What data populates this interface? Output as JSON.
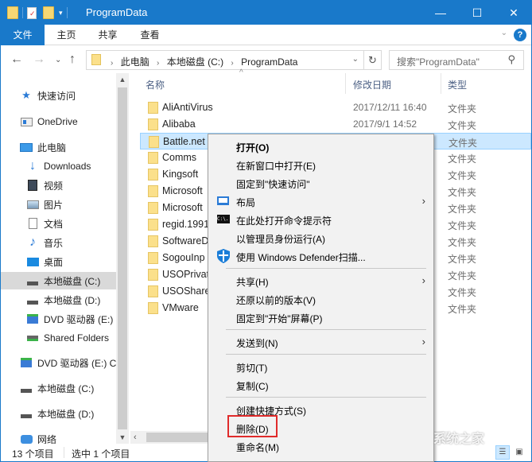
{
  "window": {
    "title": "ProgramData",
    "controls": {
      "minimize": "—",
      "maximize": "☐",
      "close": "✕"
    }
  },
  "ribbon": {
    "tabs": [
      {
        "label": "文件",
        "active": true
      },
      {
        "label": "主页"
      },
      {
        "label": "共享"
      },
      {
        "label": "查看"
      }
    ],
    "help": "?",
    "expand": "⌄"
  },
  "navigation": {
    "back": "←",
    "forward": "→",
    "recent": "⌄",
    "up": "↑",
    "breadcrumbs": [
      "此电脑",
      "本地磁盘 (C:)",
      "ProgramData"
    ],
    "separator": "›",
    "dropdown": "⌄",
    "refresh": "↻",
    "search_placeholder": "搜索\"ProgramData\"",
    "search_icon": "⚲"
  },
  "sidebar": {
    "items": [
      {
        "label": "快速访问",
        "icon": "star-icon"
      },
      {
        "label": "OneDrive",
        "icon": "onedrive-icon"
      },
      {
        "label": "此电脑",
        "icon": "computer-icon"
      },
      {
        "label": "Downloads",
        "icon": "download-icon"
      },
      {
        "label": "视频",
        "icon": "video-icon"
      },
      {
        "label": "图片",
        "icon": "picture-icon"
      },
      {
        "label": "文档",
        "icon": "document-icon"
      },
      {
        "label": "音乐",
        "icon": "music-icon"
      },
      {
        "label": "桌面",
        "icon": "desktop-icon"
      },
      {
        "label": "本地磁盘 (C:)",
        "icon": "windows-drive-icon",
        "selected": true
      },
      {
        "label": "本地磁盘 (D:)",
        "icon": "drive-icon"
      },
      {
        "label": "DVD 驱动器 (E:)",
        "icon": "dvd-icon"
      },
      {
        "label": "Shared Folders",
        "icon": "network-drive-icon"
      },
      {
        "label": "DVD 驱动器 (E:) C",
        "icon": "dvd-icon"
      },
      {
        "label": "本地磁盘 (C:)",
        "icon": "windows-drive-icon"
      },
      {
        "label": "本地磁盘 (D:)",
        "icon": "drive-icon"
      },
      {
        "label": "网络",
        "icon": "network-icon"
      }
    ]
  },
  "filelist": {
    "sort_indicator": "^",
    "columns": [
      "名称",
      "修改日期",
      "类型"
    ],
    "rows": [
      {
        "name": "AliAntiVirus",
        "date": "2017/12/11 16:40",
        "type": "文件夹"
      },
      {
        "name": "Alibaba",
        "date": "2017/9/1 14:52",
        "type": "文件夹"
      },
      {
        "name": "Battle.net",
        "date": "",
        "type": "文件夹",
        "selected": true
      },
      {
        "name": "Comms",
        "date": "",
        "type": "文件夹"
      },
      {
        "name": "Kingsoft",
        "date": "",
        "type": "文件夹"
      },
      {
        "name": "Microsoft",
        "date": "",
        "type": "文件夹"
      },
      {
        "name": "Microsoft",
        "date": "",
        "type": "文件夹"
      },
      {
        "name": "regid.1991",
        "date": "",
        "type": "文件夹"
      },
      {
        "name": "SoftwareD",
        "date": "",
        "type": "文件夹"
      },
      {
        "name": "SogouInp",
        "date": "",
        "type": "文件夹"
      },
      {
        "name": "USOPrivat",
        "date": "",
        "type": "文件夹"
      },
      {
        "name": "USOShare",
        "date": "",
        "type": "文件夹"
      },
      {
        "name": "VMware",
        "date": "",
        "type": "文件夹"
      }
    ]
  },
  "context_menu": {
    "items": [
      {
        "label": "打开(O)",
        "bold": true
      },
      {
        "label": "在新窗口中打开(E)"
      },
      {
        "label": "固定到\"快速访问\""
      },
      {
        "label": "布局",
        "icon": "layout-icon",
        "submenu": true
      },
      {
        "label": "在此处打开命令提示符",
        "icon": "cmd-icon"
      },
      {
        "label": "以管理员身份运行(A)"
      },
      {
        "label": "使用 Windows Defender扫描...",
        "icon": "defender-shield-icon"
      },
      {
        "separator": true
      },
      {
        "label": "共享(H)",
        "submenu": true
      },
      {
        "label": "还原以前的版本(V)"
      },
      {
        "label": "固定到\"开始\"屏幕(P)"
      },
      {
        "separator": true
      },
      {
        "label": "发送到(N)",
        "submenu": true
      },
      {
        "separator": true
      },
      {
        "label": "剪切(T)"
      },
      {
        "label": "复制(C)"
      },
      {
        "separator": true
      },
      {
        "label": "创建快捷方式(S)"
      },
      {
        "label": "删除(D)",
        "highlighted": true
      },
      {
        "label": "重命名(M)"
      }
    ],
    "submenu_arrow": "›",
    "cmd_icon_text": "C:\\."
  },
  "statusbar": {
    "item_count": "13 个项目",
    "selected_count": "选中 1 个项目"
  },
  "watermark": "系统之家",
  "colors": {
    "accent": "#1979ca",
    "selection": "#cce8ff",
    "highlight_box": "#e02b2b"
  }
}
